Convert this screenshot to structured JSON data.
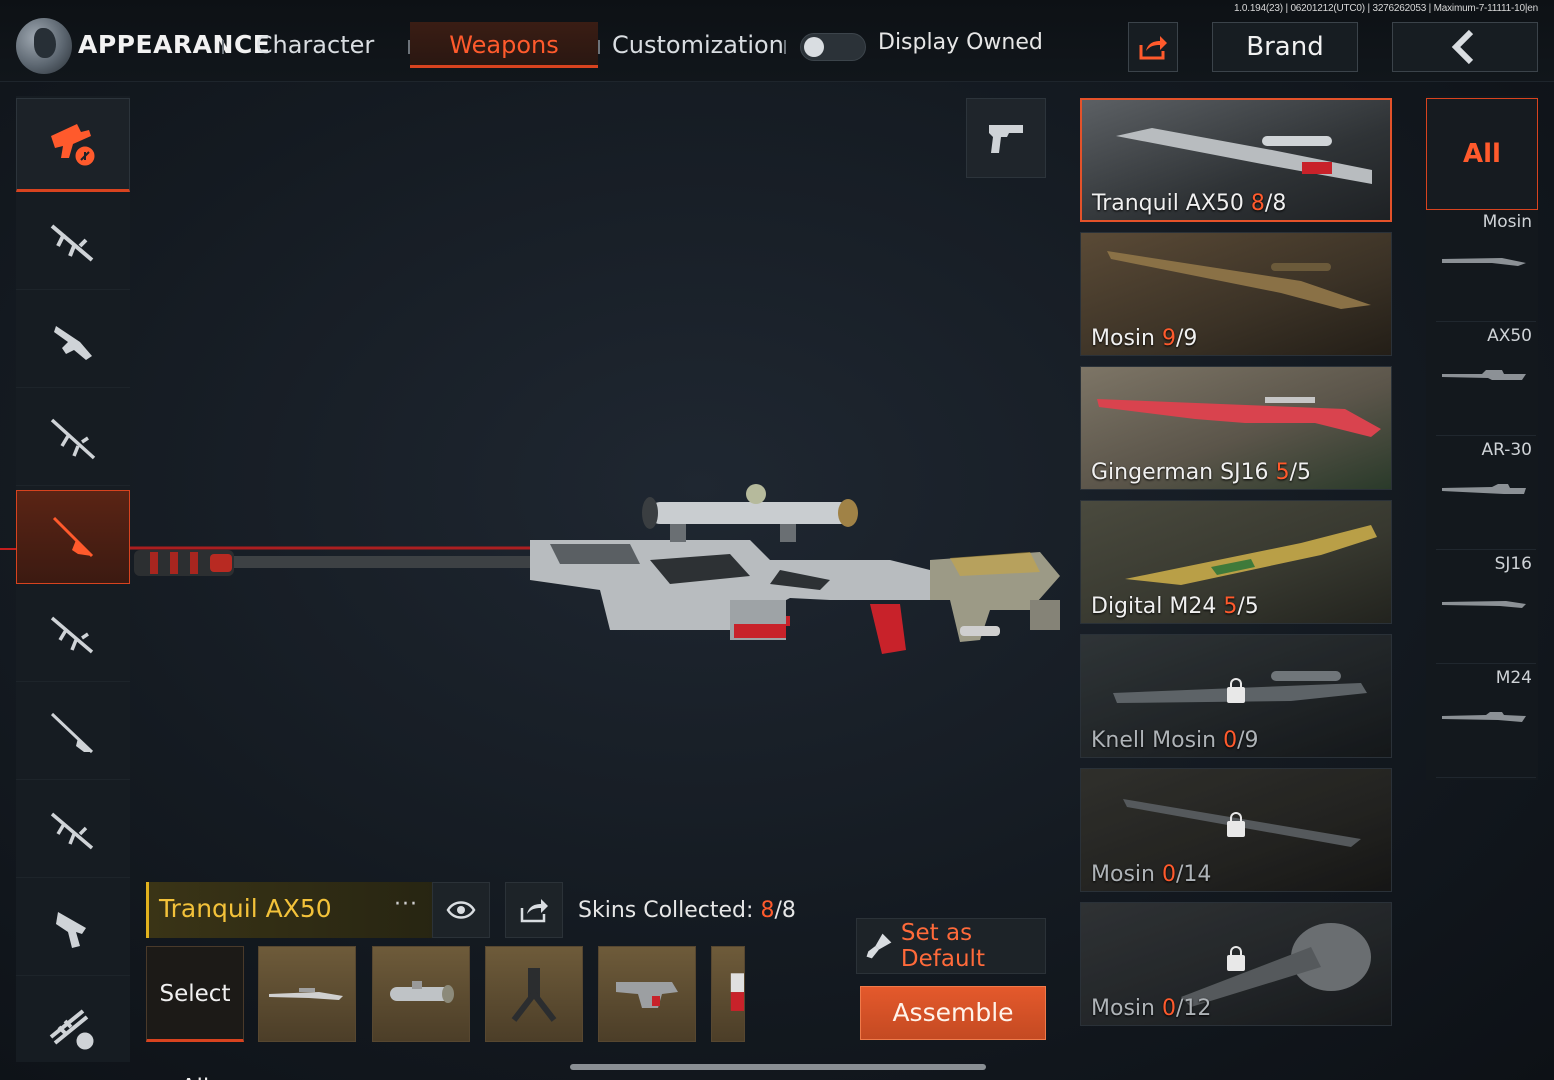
{
  "version_info": "1.0.194(23) | 06201212(UTC0) | 3276262053 | Maximum-7-11111-10|en",
  "header": {
    "title": "APPEARANCE",
    "tabs": [
      {
        "label": "Character"
      },
      {
        "label": "Weapons",
        "active": true
      },
      {
        "label": "Customization"
      }
    ],
    "display_owned_label": "Display Owned",
    "display_owned_on": false,
    "brand_label": "Brand"
  },
  "categories": [
    {
      "icon": "all-weapons-icon",
      "active": true
    },
    {
      "icon": "assault-rifle-icon"
    },
    {
      "icon": "smg-icon"
    },
    {
      "icon": "lmg-icon"
    },
    {
      "icon": "sniper-rifle-icon",
      "active": true
    },
    {
      "icon": "marksman-rifle-icon"
    },
    {
      "icon": "shotgun-icon"
    },
    {
      "icon": "carbine-icon"
    },
    {
      "icon": "pistol-icon"
    },
    {
      "icon": "melee-throwable-icon"
    }
  ],
  "skins": [
    {
      "name": "Tranquil AX50",
      "owned": "8",
      "total": "/8",
      "selected": true,
      "locked": false,
      "tone": "#3b3f42"
    },
    {
      "name": "Mosin",
      "owned": "9",
      "total": "/9",
      "locked": false,
      "tone": "#4a4030"
    },
    {
      "name": "Gingerman SJ16",
      "owned": "5",
      "total": "/5",
      "locked": false,
      "tone": "#6a6254"
    },
    {
      "name": "Digital M24",
      "owned": "5",
      "total": "/5",
      "locked": false,
      "tone": "#3e4036"
    },
    {
      "name": "Knell Mosin",
      "owned": "0",
      "total": "/9",
      "locked": true,
      "tone": "#2b3034"
    },
    {
      "name": "Mosin",
      "owned": "0",
      "total": "/14",
      "locked": true,
      "tone": "#2e2f2c"
    },
    {
      "name": "Mosin",
      "owned": "0",
      "total": "/12",
      "locked": true,
      "tone": "#2c3033"
    }
  ],
  "filters": {
    "all_label": "All",
    "items": [
      {
        "label": "Mosin"
      },
      {
        "label": "AX50"
      },
      {
        "label": "AR-30"
      },
      {
        "label": "SJ16"
      },
      {
        "label": "M24"
      }
    ]
  },
  "current": {
    "name": "Tranquil AX50",
    "more": "···",
    "collected_label": "Skins Collected: ",
    "collected_owned": "8",
    "collected_total": "/8"
  },
  "parts": {
    "select_all_label": "Select All",
    "items": [
      "rifle-part-icon",
      "scope-part-icon",
      "bipod-part-icon",
      "receiver-part-icon",
      "stock-part-icon"
    ]
  },
  "actions": {
    "set_default_label": "Set as Default",
    "assemble_label": "Assemble"
  },
  "colors": {
    "accent": "#ff5a2c",
    "gold": "#f3c23a"
  }
}
